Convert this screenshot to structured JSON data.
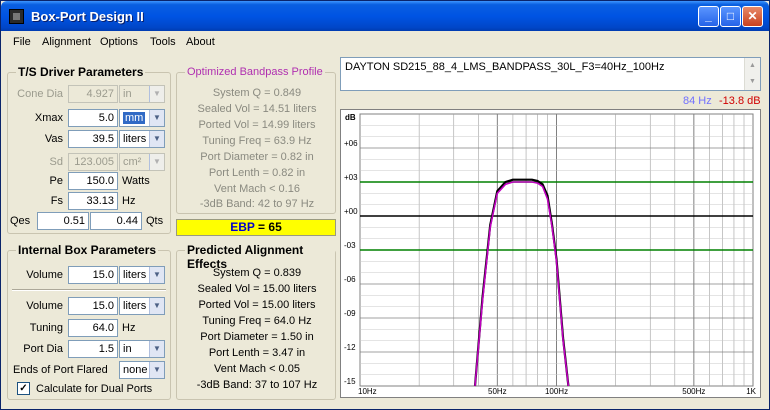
{
  "window": {
    "title": "Box-Port Design II"
  },
  "menu": [
    "File",
    "Alignment",
    "Options",
    "Tools",
    "About"
  ],
  "ts_params": {
    "title": "T/S Driver Parameters",
    "cone_dia": {
      "label": "Cone Dia",
      "value": "4.927",
      "unit": "in"
    },
    "xmax": {
      "label": "Xmax",
      "value": "5.0",
      "unit": "mm"
    },
    "vas": {
      "label": "Vas",
      "value": "39.5",
      "unit": "liters"
    },
    "sd": {
      "label": "Sd",
      "value": "123.005",
      "unit": "cm²"
    },
    "pe": {
      "label": "Pe",
      "value": "150.0",
      "unit": "Watts"
    },
    "fs": {
      "label": "Fs",
      "value": "33.13",
      "unit": "Hz"
    },
    "qes": {
      "label": "Qes",
      "value": "0.51"
    },
    "qts": {
      "label": "Qts",
      "value": "0.44"
    }
  },
  "optimized": {
    "title": "Optimized Bandpass Profile",
    "lines": [
      "System Q = 0.849",
      "Sealed Vol = 14.51 liters",
      "Ported Vol = 14.99 liters",
      "Tuning Freq = 63.9 Hz",
      "Port Diameter = 0.82 in",
      "Port Lenth = 0.82 in",
      "Vent Mach < 0.16",
      "-3dB Band: 42 to 97 Hz"
    ]
  },
  "ebp": {
    "label": "EBP",
    "value": "= 65"
  },
  "internal": {
    "title": "Internal Box Parameters",
    "volume1": {
      "label": "Volume",
      "value": "15.0",
      "unit": "liters"
    },
    "volume2": {
      "label": "Volume",
      "value": "15.0",
      "unit": "liters"
    },
    "tuning": {
      "label": "Tuning",
      "value": "64.0",
      "unit": "Hz"
    },
    "port_dia": {
      "label": "Port Dia",
      "value": "1.5",
      "unit": "in"
    },
    "ends_flared": {
      "label": "Ends of Port Flared",
      "value": "none"
    },
    "dual_ports": {
      "label": "Calculate for Dual Ports",
      "checked": "✓"
    }
  },
  "predicted": {
    "title": "Predicted Alignment Effects",
    "lines": [
      "System Q = 0.839",
      "Sealed Vol = 15.00 liters",
      "Ported Vol = 15.00 liters",
      "Tuning Freq = 64.0 Hz",
      "Port Diameter = 1.50 in",
      "Port Lenth = 3.47 in",
      "Vent Mach < 0.05",
      "-3dB Band: 37 to 107 Hz"
    ]
  },
  "description": "DAYTON SD215_88_4_LMS_BANDPASS_30L_F3=40Hz_100Hz",
  "readout": {
    "freq": "84 Hz",
    "db": "-13.8 dB"
  },
  "chart_data": {
    "type": "line",
    "ylabel": "dB",
    "y_ticks": [
      "+06",
      "+03",
      "+00",
      "-03",
      "-06",
      "-09",
      "-12",
      "-15"
    ],
    "y_range": [
      -15,
      9
    ],
    "x_range": [
      10,
      1000
    ],
    "x_scale": "log",
    "x_ticks": [
      "10Hz",
      "50Hz",
      "100Hz",
      "500Hz",
      "1K"
    ],
    "x_tick_values": [
      10,
      50,
      100,
      500,
      1000
    ],
    "reference_lines": [
      3,
      0,
      -3
    ],
    "colors": {
      "reference": "#008000",
      "zero": "#000000",
      "grid": "#a0a0a0",
      "curve": "#000000",
      "curve2": "#c000c0"
    },
    "series": [
      {
        "x": [
          38.5,
          42,
          46,
          50,
          55,
          60,
          65,
          70,
          75,
          80,
          85,
          90,
          95,
          100,
          108,
          115
        ],
        "y": [
          -15,
          -7.5,
          -1,
          2.0,
          2.8,
          3.0,
          3.0,
          3.0,
          3.0,
          2.9,
          2.6,
          1.5,
          -1,
          -4,
          -11,
          -15
        ]
      },
      {
        "x": [
          38.5,
          42,
          46,
          50,
          55,
          60,
          65,
          70,
          75,
          80,
          85,
          90,
          95,
          100,
          108,
          115
        ],
        "y": [
          -15,
          -7.2,
          -0.8,
          2.2,
          3.0,
          3.2,
          3.2,
          3.2,
          3.2,
          3.1,
          2.8,
          1.8,
          -0.8,
          -3.8,
          -10.8,
          -15
        ]
      }
    ]
  }
}
